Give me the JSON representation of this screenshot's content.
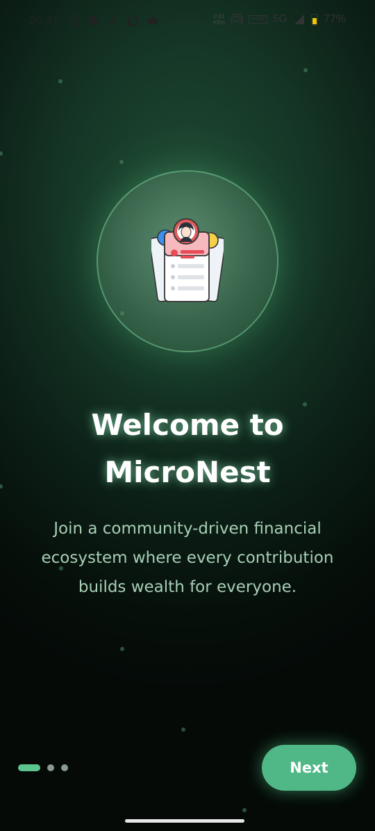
{
  "status_bar": {
    "time": "20:41",
    "left_icons": [
      "whatsapp-icon",
      "snapchat-icon",
      "z-icon",
      "copy-icon",
      "cloud-icon"
    ],
    "z_glyph": "Z",
    "network_speed_value": "0.61",
    "network_speed_unit": "KB/s",
    "volte_label": "VoLTE",
    "network_type": "5G",
    "battery_percent": "77%"
  },
  "hero": {
    "illustration": "profile-cards-illustration"
  },
  "onboarding": {
    "title_line1": "Welcome to",
    "title_line2": "MicroNest",
    "subtitle_line1": "Join a community-driven financial",
    "subtitle_line2": "ecosystem where every contribution",
    "subtitle_line3": "builds wealth for everyone."
  },
  "pager": {
    "total_pages": 3,
    "active_index": 0
  },
  "actions": {
    "next_label": "Next"
  },
  "colors": {
    "accent": "#50b886",
    "background": "#0c2017",
    "subtitle": "#a8cfb6"
  }
}
